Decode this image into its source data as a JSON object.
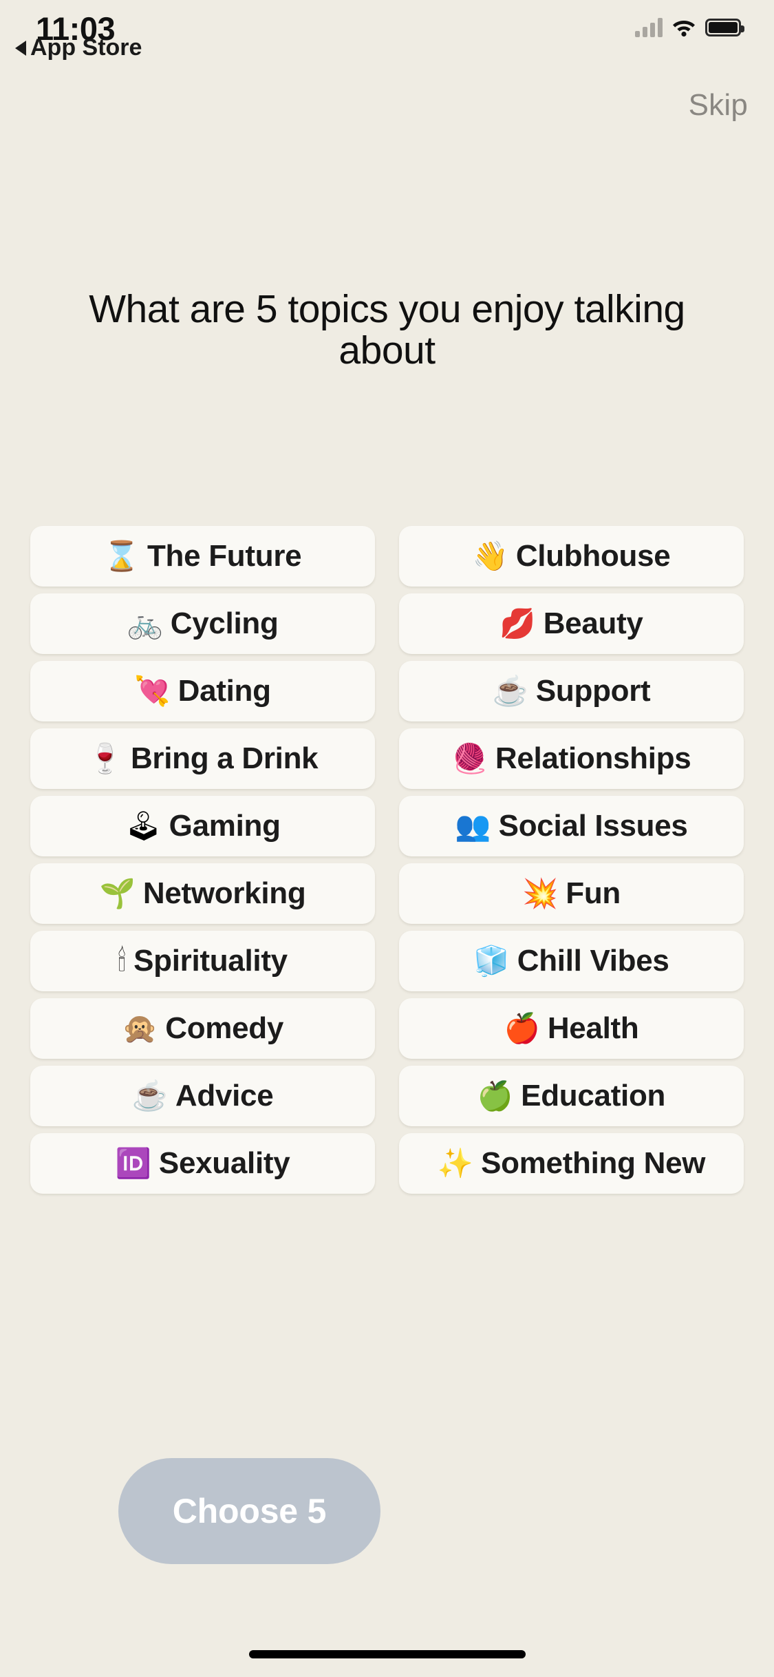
{
  "status_bar": {
    "time": "11:03",
    "back_label": "App Store",
    "signal_icon": "cellular-signal-icon",
    "wifi_icon": "wifi-icon",
    "battery_icon": "battery-icon"
  },
  "header": {
    "skip_label": "Skip",
    "title": "What are 5 topics you enjoy talking about"
  },
  "topics": [
    {
      "emoji": "⌛",
      "emoji_name": "hourglass-emoji",
      "label": "The Future"
    },
    {
      "emoji": "👋",
      "emoji_name": "waving-hand-emoji",
      "label": "Clubhouse"
    },
    {
      "emoji": "🚲",
      "emoji_name": "bicycle-emoji",
      "label": "Cycling"
    },
    {
      "emoji": "💋",
      "emoji_name": "kiss-mark-emoji",
      "label": "Beauty"
    },
    {
      "emoji": "💘",
      "emoji_name": "heart-with-arrow-emoji",
      "label": "Dating"
    },
    {
      "emoji": "☕",
      "emoji_name": "hot-beverage-emoji",
      "label": "Support"
    },
    {
      "emoji": "🍷",
      "emoji_name": "wine-glass-emoji",
      "label": "Bring a Drink"
    },
    {
      "emoji": "🧶",
      "emoji_name": "yarn-emoji",
      "label": "Relationships"
    },
    {
      "emoji": "🕹",
      "emoji_name": "joystick-emoji",
      "label": "Gaming"
    },
    {
      "emoji": "👥",
      "emoji_name": "busts-in-silhouette-emoji",
      "label": "Social Issues"
    },
    {
      "emoji": "🌱",
      "emoji_name": "seedling-emoji",
      "label": "Networking"
    },
    {
      "emoji": "💥",
      "emoji_name": "collision-emoji",
      "label": "Fun"
    },
    {
      "emoji": "🕯",
      "emoji_name": "candle-emoji",
      "label": "Spirituality"
    },
    {
      "emoji": "🧊",
      "emoji_name": "ice-cube-emoji",
      "label": "Chill Vibes"
    },
    {
      "emoji": "🙊",
      "emoji_name": "speak-no-evil-monkey-emoji",
      "label": "Comedy"
    },
    {
      "emoji": "🍎",
      "emoji_name": "red-apple-emoji",
      "label": "Health"
    },
    {
      "emoji": "☕",
      "emoji_name": "hot-beverage-emoji",
      "label": "Advice"
    },
    {
      "emoji": "🍏",
      "emoji_name": "green-apple-emoji",
      "label": "Education"
    },
    {
      "emoji": "🆔",
      "emoji_name": "id-button-emoji",
      "label": "Sexuality"
    },
    {
      "emoji": "✨",
      "emoji_name": "sparkles-emoji",
      "label": "Something New"
    }
  ],
  "footer": {
    "choose_label": "Choose 5"
  },
  "colors": {
    "background": "#efece3",
    "chip_background": "#faf9f5",
    "choose_button": "#bcc4ce",
    "title_text": "#101010",
    "skip_text": "#8a8782"
  }
}
